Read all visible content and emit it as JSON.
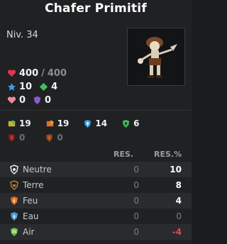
{
  "title": "Chafer Primitif",
  "level": "Niv. 34",
  "stats": {
    "hp_current": "400",
    "hp_sep": "/",
    "hp_max": "400",
    "ap": "10",
    "mp": "4",
    "heal_bonus": "0",
    "shield": "0"
  },
  "damage_row": {
    "a": "19",
    "b": "19",
    "c": "14",
    "d": "6"
  },
  "damage_row2": {
    "a": "0",
    "b": "0"
  },
  "res_table": {
    "col_res": "RES.",
    "col_res_pct": "RES.%",
    "rows": [
      {
        "name": "Neutre",
        "res": "0",
        "res_pct": "10",
        "color": "#e8e8e8"
      },
      {
        "name": "Terre",
        "res": "0",
        "res_pct": "8",
        "color": "#b07a3a"
      },
      {
        "name": "Feu",
        "res": "0",
        "res_pct": "4",
        "color": "#e0712a"
      },
      {
        "name": "Eau",
        "res": "0",
        "res_pct": "0",
        "color": "#4a9bd6"
      },
      {
        "name": "Air",
        "res": "0",
        "res_pct": "-4",
        "color": "#6fbf4a"
      }
    ]
  },
  "colors": {
    "hp": "#e0374a",
    "ap": "#3aa0e6",
    "mp": "#3fbf5a",
    "negative": "#e0474c"
  }
}
